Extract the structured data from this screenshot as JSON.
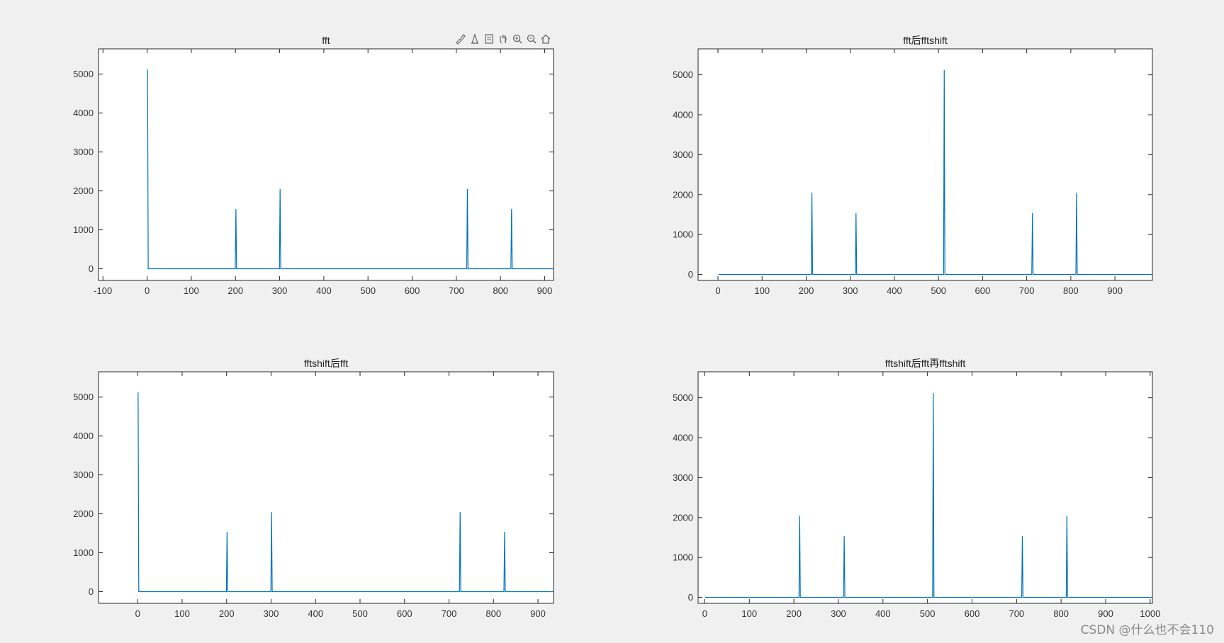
{
  "toolbar": {
    "icons": [
      "brush-icon",
      "datatip-icon",
      "legend-icon",
      "pan-icon",
      "zoom-in-icon",
      "zoom-out-icon",
      "home-icon"
    ]
  },
  "watermark": "CSDN @什么也不会110",
  "chart_data": [
    {
      "type": "line",
      "title": "fft",
      "xlim": [
        -110,
        920
      ],
      "ylim": [
        -300,
        5650
      ],
      "xticks": [
        -100,
        0,
        100,
        200,
        300,
        400,
        500,
        600,
        700,
        800,
        900
      ],
      "yticks": [
        0,
        1000,
        2000,
        3000,
        4000,
        5000
      ],
      "color": "#0072bd",
      "baseline_range": [
        1,
        1024
      ],
      "spikes": [
        {
          "x": 1,
          "y": 5120
        },
        {
          "x": 201,
          "y": 1536
        },
        {
          "x": 301,
          "y": 2048
        },
        {
          "x": 725,
          "y": 2048
        },
        {
          "x": 825,
          "y": 1536
        }
      ]
    },
    {
      "type": "line",
      "title": "fft后fftshift",
      "xlim": [
        -45,
        985
      ],
      "ylim": [
        -150,
        5650
      ],
      "xticks": [
        0,
        100,
        200,
        300,
        400,
        500,
        600,
        700,
        800,
        900
      ],
      "yticks": [
        0,
        1000,
        2000,
        3000,
        4000,
        5000
      ],
      "color": "#0072bd",
      "baseline_range": [
        1,
        1024
      ],
      "spikes": [
        {
          "x": 213,
          "y": 2048
        },
        {
          "x": 313,
          "y": 1536
        },
        {
          "x": 513,
          "y": 5120
        },
        {
          "x": 713,
          "y": 1536
        },
        {
          "x": 813,
          "y": 2048
        }
      ]
    },
    {
      "type": "line",
      "title": "fftshift后fft",
      "xlim": [
        -88,
        935
      ],
      "ylim": [
        -300,
        5650
      ],
      "xticks": [
        0,
        100,
        200,
        300,
        400,
        500,
        600,
        700,
        800,
        900
      ],
      "yticks": [
        0,
        1000,
        2000,
        3000,
        4000,
        5000
      ],
      "color": "#0072bd",
      "baseline_range": [
        1,
        1024
      ],
      "spikes": [
        {
          "x": 1,
          "y": 5120
        },
        {
          "x": 201,
          "y": 1536
        },
        {
          "x": 301,
          "y": 2048
        },
        {
          "x": 725,
          "y": 2048
        },
        {
          "x": 825,
          "y": 1536
        }
      ]
    },
    {
      "type": "line",
      "title": "fftshift后fft再fftshift",
      "xlim": [
        -15,
        1005
      ],
      "ylim": [
        -150,
        5650
      ],
      "xticks": [
        0,
        100,
        200,
        300,
        400,
        500,
        600,
        700,
        800,
        900,
        1000
      ],
      "yticks": [
        0,
        1000,
        2000,
        3000,
        4000,
        5000
      ],
      "color": "#0072bd",
      "baseline_range": [
        1,
        1024
      ],
      "spikes": [
        {
          "x": 213,
          "y": 2048
        },
        {
          "x": 313,
          "y": 1536
        },
        {
          "x": 513,
          "y": 5120
        },
        {
          "x": 713,
          "y": 1536
        },
        {
          "x": 813,
          "y": 2048
        }
      ]
    }
  ]
}
